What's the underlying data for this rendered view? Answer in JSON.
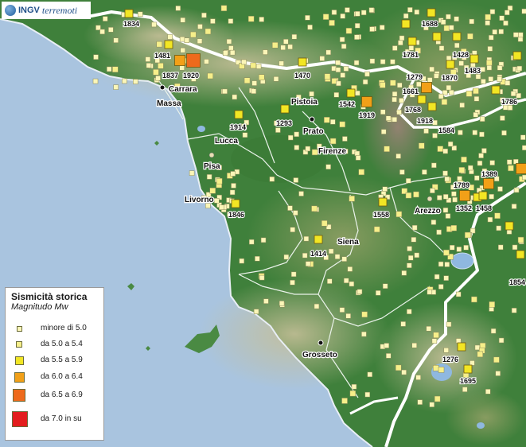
{
  "logo": {
    "brand": "INGV",
    "product": "terremoti"
  },
  "legend": {
    "title": "Sismicità storica",
    "subtitle": "Magnitudo Mw",
    "classes": [
      {
        "label": "minore di 5.0",
        "color": "#fbf6b8"
      },
      {
        "label": "da 5.0 a 5.4",
        "color": "#f6ef8a"
      },
      {
        "label": "da 5.5 a 5.9",
        "color": "#f2e624"
      },
      {
        "label": "da 6.0 a 6.4",
        "color": "#f2a018"
      },
      {
        "label": "da 6.5 a 6.9",
        "color": "#ee6a1c"
      },
      {
        "label": "da 7.0 in su",
        "color": "#e31d1d"
      }
    ]
  },
  "cities": [
    "Carrara",
    "Massa",
    "Pistoia",
    "Prato",
    "Lucca",
    "Pisa",
    "Firenze",
    "Livorno",
    "Arezzo",
    "Siena",
    "Grosseto"
  ],
  "years": [
    "1834",
    "1688",
    "1481",
    "1920",
    "1837",
    "1781",
    "1428",
    "1470",
    "1870",
    "1483",
    "1279",
    "1661",
    "1542",
    "1919",
    "1768",
    "1786",
    "1918",
    "1584",
    "1293",
    "1914",
    "1389",
    "1789",
    "1352",
    "1458",
    "1846",
    "1558",
    "1414",
    "1276",
    "1695",
    "1854"
  ],
  "colors": {
    "sea": "#a9c4df",
    "land_low": "#3d7e3a",
    "land_high": "#b7b18a",
    "border": "#ffffff",
    "lake": "#8fb8e0"
  }
}
